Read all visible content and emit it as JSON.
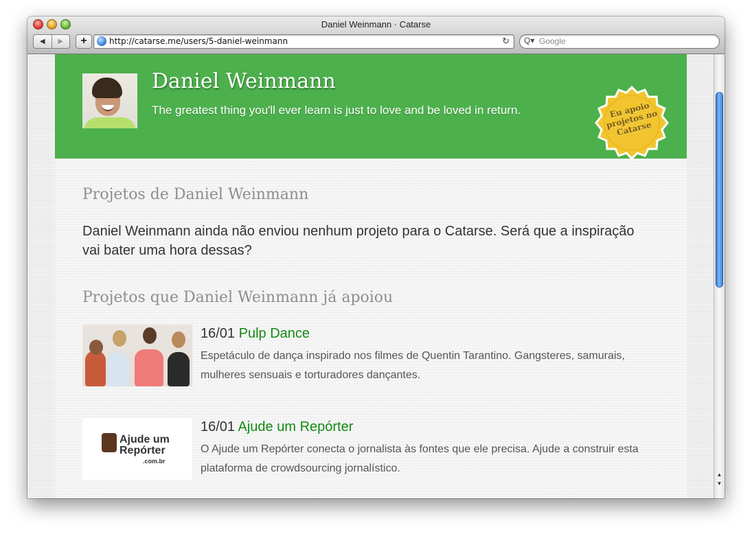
{
  "window": {
    "title": "Daniel Weinmann · Catarse"
  },
  "toolbar": {
    "back_glyph": "◀",
    "forward_glyph": "▶",
    "add_glyph": "+",
    "url": "http://catarse.me/users/5-daniel-weinmann",
    "reload_glyph": "↻",
    "search_glyph": "Q▾",
    "search_placeholder": "Google"
  },
  "profile": {
    "name": "Daniel Weinmann",
    "bio": "The greatest thing you'll ever learn is just to love and be loved in return.",
    "badge_text": "Eu apoio projetos no Catarse"
  },
  "own_projects": {
    "title": "Projetos de Daniel Weinmann",
    "empty_message": "Daniel Weinmann ainda não enviou nenhum projeto para o Catarse. Será que a inspiração vai bater uma hora dessas?"
  },
  "backed_projects": {
    "title": "Projetos que Daniel Weinmann já apoiou",
    "items": [
      {
        "date": "16/01",
        "name": "Pulp Dance",
        "description": "Espetáculo de dança inspirado nos filmes de Quentin Tarantino. Gangsteres, samurais, mulheres sensuais e torturadores dançantes."
      },
      {
        "date": "16/01",
        "name": "Ajude um Repórter",
        "description": "O Ajude um Repórter conecta o jornalista às fontes que ele precisa. Ajude a construir esta plataforma de crowdsourcing jornalístico.",
        "logo_text_line1": "Ajude um",
        "logo_text_line2": "Repórter",
        "logo_sub": ".com.br"
      }
    ]
  },
  "colors": {
    "header_green": "#4cb04c",
    "link_green": "#138a13",
    "badge_gold": "#f2c52e"
  }
}
